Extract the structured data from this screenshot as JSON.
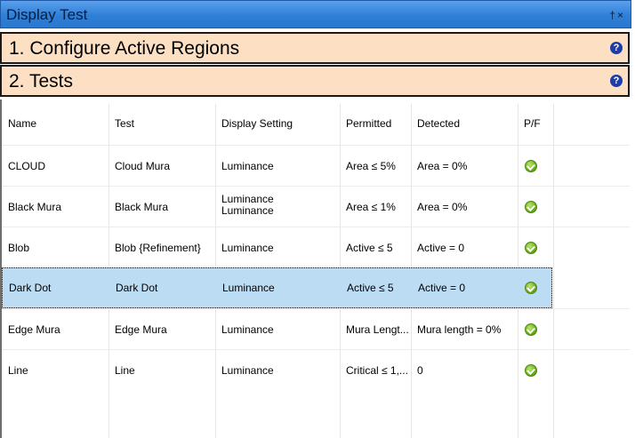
{
  "window": {
    "title": "Display Test",
    "pin_icon": "pin-icon",
    "close_icon": "close-icon",
    "controls_text": "†×"
  },
  "sections": [
    {
      "label": "1. Configure Active Regions",
      "help": "?"
    },
    {
      "label": "2. Tests",
      "help": "?"
    }
  ],
  "table": {
    "headers": [
      "Name",
      "Test",
      "Display Setting",
      "Permitted",
      "Detected",
      "P/F"
    ],
    "rows": [
      {
        "name": "CLOUD",
        "test": "Cloud Mura",
        "setting": "Luminance",
        "setting2": "",
        "permitted": "Area ≤ 5%",
        "detected": "Area = 0%",
        "pf": "pass"
      },
      {
        "name": "Black Mura",
        "test": "Black Mura",
        "setting": "Luminance",
        "setting2": "Luminance",
        "permitted": "Area ≤ 1%",
        "detected": "Area = 0%",
        "pf": "pass"
      },
      {
        "name": "Blob",
        "test": "Blob {Refinement}",
        "setting": "Luminance",
        "setting2": "",
        "permitted": "Active ≤ 5",
        "detected": "Active = 0",
        "pf": "pass"
      },
      {
        "name": "Dark Dot",
        "test": "Dark Dot",
        "setting": "Luminance",
        "setting2": "",
        "permitted": "Active ≤ 5",
        "detected": "Active = 0",
        "pf": "pass"
      },
      {
        "name": "Edge Mura",
        "test": "Edge Mura",
        "setting": "Luminance",
        "setting2": "",
        "permitted": "Mura Lengt...",
        "detected": "Mura length = 0%",
        "pf": "pass"
      },
      {
        "name": "Line",
        "test": "Line",
        "setting": "Luminance",
        "setting2": "",
        "permitted": "Critical ≤ 1,...",
        "detected": "0",
        "pf": "pass"
      }
    ],
    "selected_row_index": 3
  },
  "colors": {
    "title_bar": "#2f7fd8",
    "section_bg": "#fde0c4",
    "selected_row": "#bcdcf4",
    "pass": "#5fa01a"
  }
}
